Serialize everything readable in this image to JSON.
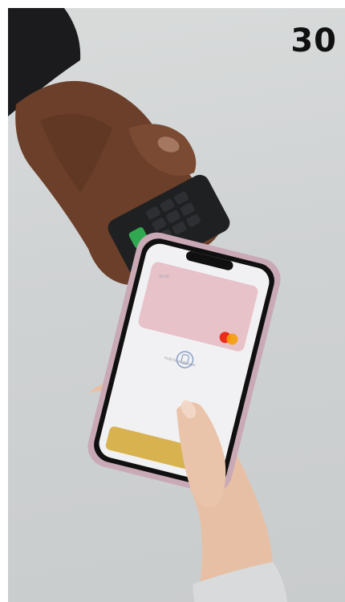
{
  "overlay": {
    "number": "30"
  },
  "phone": {
    "time": "10:10",
    "prompt": "Hold Near Reader"
  },
  "colors": {
    "background": "#cfd2d3",
    "sleeve": "#1b1b1d",
    "terminal": "#1f2022",
    "terminal_green_key": "#2fa84f",
    "terminal_yellow_key": "#e3c53a",
    "phone_case": "#c9a9b6",
    "card": "#e7c2c9",
    "mastercard_red": "#eb2c1b",
    "mastercard_orange": "#f59e0b",
    "gold_card": "#d8b24f",
    "skin_dark": "#6b3f2a",
    "skin_light": "#e7bfa5"
  },
  "icons": [
    "contactless-pay-icon",
    "mastercard-logo-icon"
  ]
}
